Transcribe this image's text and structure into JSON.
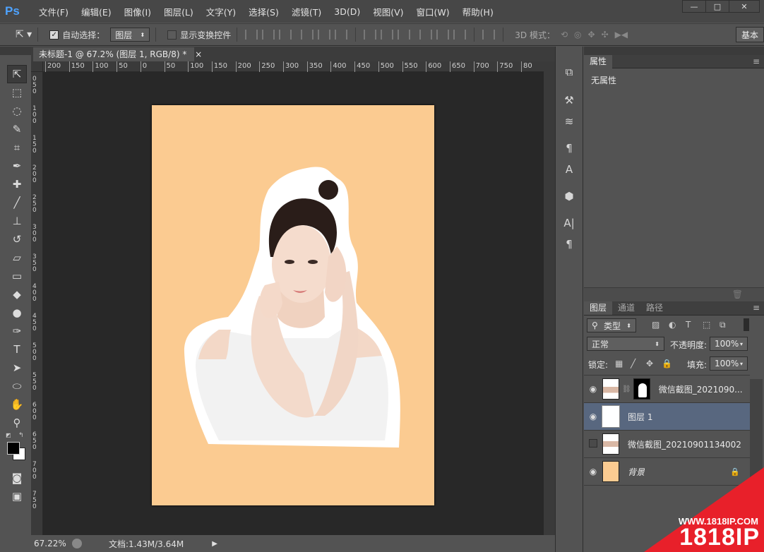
{
  "app": {
    "logo": "Ps"
  },
  "menu": [
    "文件(F)",
    "编辑(E)",
    "图像(I)",
    "图层(L)",
    "文字(Y)",
    "选择(S)",
    "滤镜(T)",
    "3D(D)",
    "视图(V)",
    "窗口(W)",
    "帮助(H)"
  ],
  "window_controls": {
    "minimize": "—",
    "restore": "□",
    "close": "✕"
  },
  "options": {
    "auto_select_label": "自动选择：",
    "auto_select_checked": true,
    "auto_select_target": "图层",
    "show_transform_label": "显示变换控件",
    "mode_3d": "3D 模式：",
    "workspace": "基本"
  },
  "document": {
    "tab_title": "未标题-1 @ 67.2% (图层 1, RGB/8) *",
    "close": "×"
  },
  "ruler_h": [
    "200",
    "150",
    "100",
    "50",
    "0",
    "50",
    "100",
    "150",
    "200",
    "250",
    "300",
    "350",
    "400",
    "450",
    "500",
    "550",
    "600",
    "650",
    "700",
    "750",
    "80"
  ],
  "ruler_v": [
    "0",
    "5",
    "0",
    "1",
    "0",
    "0",
    "1",
    "5",
    "0",
    "2",
    "0",
    "0",
    "2",
    "5",
    "0",
    "3",
    "0",
    "0",
    "3",
    "5",
    "0",
    "4",
    "0",
    "0",
    "4",
    "5",
    "0",
    "5",
    "0",
    "0",
    "5",
    "5",
    "0",
    "6",
    "0",
    "0",
    "6",
    "5",
    "0",
    "7",
    "0",
    "0",
    "7",
    "5",
    "0"
  ],
  "status": {
    "zoom": "67.22%",
    "doc_info": "文档:1.43M/3.64M"
  },
  "properties": {
    "tab": "属性",
    "body": "无属性"
  },
  "layers_panel": {
    "tabs": [
      "图层",
      "通道",
      "路径"
    ],
    "filter_label": "类型",
    "blend_mode": "正常",
    "opacity_label": "不透明度:",
    "opacity": "100%",
    "lock_label": "锁定:",
    "fill_label": "填充:",
    "fill": "100%",
    "layers": [
      {
        "name": "微信截图_2021090...",
        "visible": true,
        "selected": false
      },
      {
        "name": "图层 1",
        "visible": true,
        "selected": true
      },
      {
        "name": "微信截图_20210901134002",
        "visible": false,
        "selected": false
      },
      {
        "name": "背景",
        "visible": true,
        "selected": false,
        "locked": true
      }
    ]
  },
  "watermark": {
    "url": "WWW.1818IP.COM",
    "brand": "1818IP"
  },
  "colors": {
    "canvas_bg": "#fbcb91",
    "selected_layer": "#58677f",
    "accent": "#e8202a"
  }
}
